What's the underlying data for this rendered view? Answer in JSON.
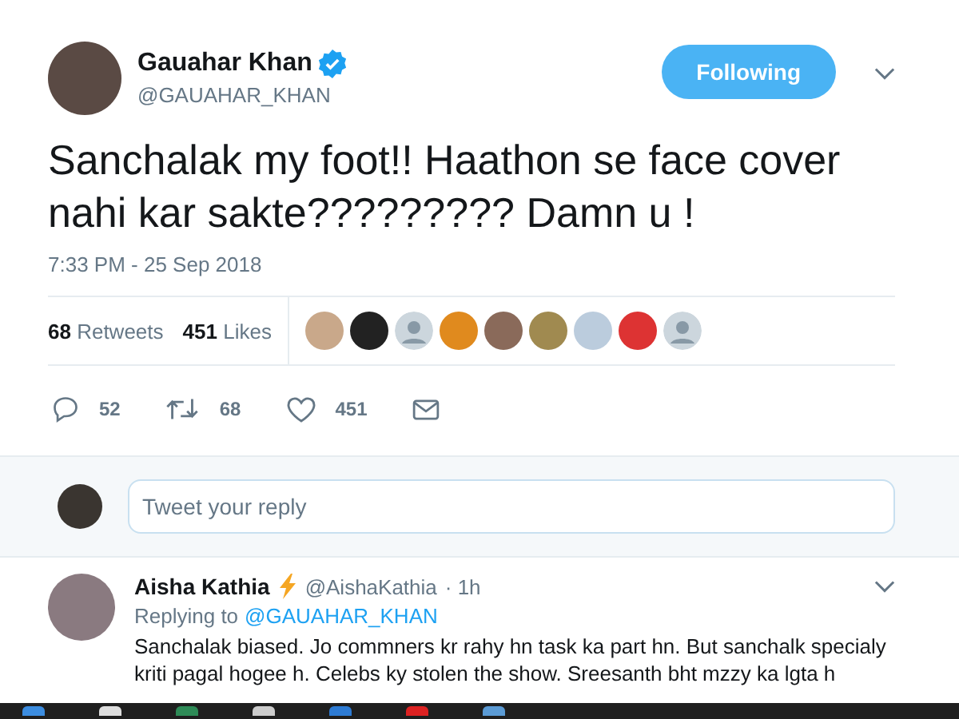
{
  "tweet": {
    "author": "Gauahar Khan",
    "verified": true,
    "handle": "@GAUAHAR_KHAN",
    "follow_button": "Following",
    "text": "Sanchalak my foot!! Haathon se face cover nahi kar sakte????????? Damn u !",
    "timestamp": "7:33 PM - 25 Sep 2018",
    "stats": [
      {
        "count": "68",
        "label": "Retweets"
      },
      {
        "count": "451",
        "label": "Likes"
      }
    ],
    "actions": [
      {
        "kind": "reply",
        "count": "52"
      },
      {
        "kind": "retweet",
        "count": "68"
      },
      {
        "kind": "like",
        "count": "451"
      },
      {
        "kind": "message"
      }
    ]
  },
  "reply_box": {
    "placeholder": "Tweet your reply"
  },
  "replies": [
    {
      "author": "Aisha Kathia",
      "handle": "@AishaKathia",
      "time": "· 1h",
      "replying_label": "Replying to",
      "replying_to": "@GAUAHAR_KHAN",
      "text": "Sanchalak biased. Jo commners kr rahy hn task ka part hn. But sanchalk specialy kriti pagal hogee h. Celebs ky stolen the show. Sreesanth bht mzzy ka lgta h"
    }
  ]
}
